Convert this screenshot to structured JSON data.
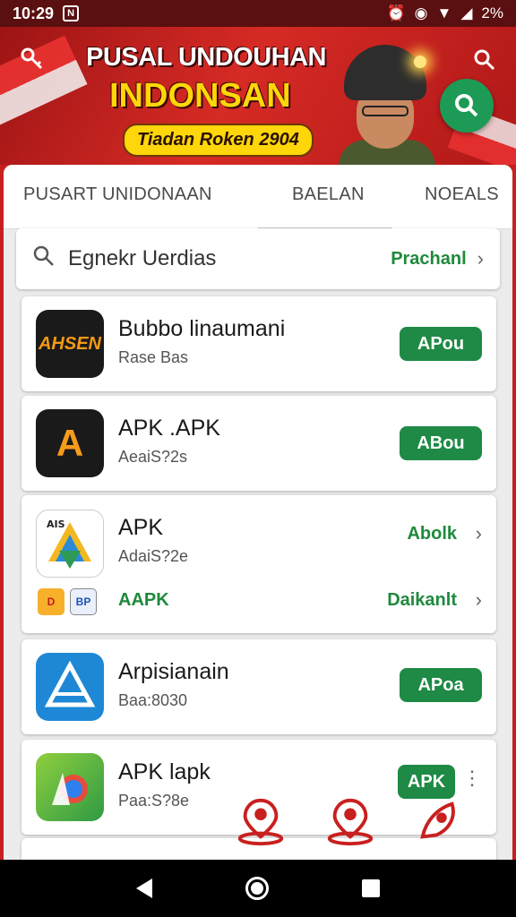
{
  "status_bar": {
    "time": "10:29",
    "notif_glyph": "N",
    "battery": "2%"
  },
  "hero": {
    "title_line1": "PUSAL UNDOUHAN",
    "title_line2": "INDONSAN",
    "pill": "Tiadan Roken 2904"
  },
  "tabs": [
    {
      "label": "PUSART UNIDONAAN"
    },
    {
      "label": "BAELAN"
    },
    {
      "label": "NOEALS"
    }
  ],
  "search": {
    "text": "Egnekr Uerdias",
    "action": "Prachanl"
  },
  "apps": [
    {
      "name": "Bubbo linaumani",
      "sub": "Rase Bas",
      "button": "APou",
      "icon_text": "AHSEN"
    },
    {
      "name": "APK .APK",
      "sub": "AeaiS?2s",
      "button": "ABou",
      "icon_text": "A"
    },
    {
      "name": "APK",
      "sub": "AdaiS?2e",
      "link": "Abolk",
      "icon_text": "AIS",
      "row2_link_left": "AAPK",
      "row2_link_right": "Daikanlt",
      "mini1": "D",
      "mini2": "BP"
    },
    {
      "name": "Arpisianain",
      "sub": "Baa:8030",
      "button": "APoa"
    },
    {
      "name": "APK lapk",
      "sub": "Paa:S?8e",
      "button": "APK"
    }
  ],
  "colors": {
    "brand_red": "#c8201f",
    "accent_green": "#1e8a45",
    "fab_green": "#1e9a57",
    "title_yellow": "#ffd60a"
  },
  "icons": [
    "key-icon",
    "search-icon",
    "map-pin-icon",
    "back-icon",
    "home-icon",
    "recents-icon"
  ]
}
